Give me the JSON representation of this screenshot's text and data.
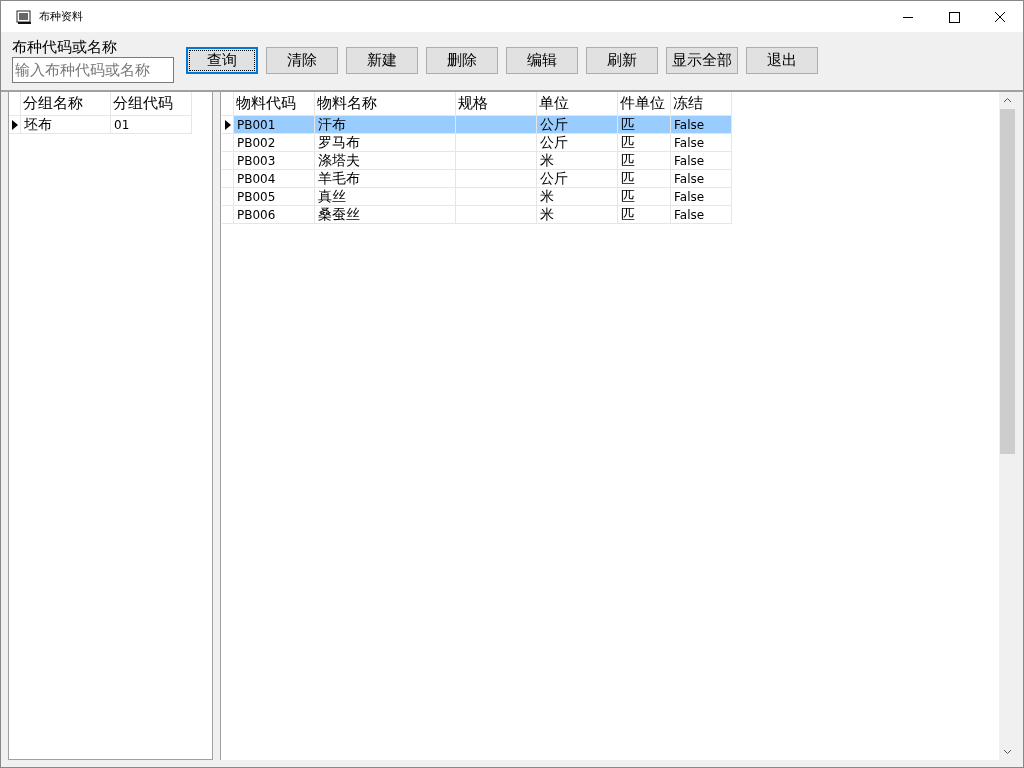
{
  "window": {
    "title": "布种资料"
  },
  "search": {
    "label": "布种代码或名称",
    "placeholder": "输入布种代码或名称"
  },
  "buttons": [
    {
      "label": "查询",
      "focused": true
    },
    {
      "label": "清除",
      "focused": false
    },
    {
      "label": "新建",
      "focused": false
    },
    {
      "label": "删除",
      "focused": false
    },
    {
      "label": "编辑",
      "focused": false
    },
    {
      "label": "刷新",
      "focused": false
    },
    {
      "label": "显示全部",
      "focused": false
    },
    {
      "label": "退出",
      "focused": false
    }
  ],
  "group_table": {
    "columns": [
      "分组名称",
      "分组代码"
    ],
    "rows": [
      {
        "cells": [
          "坯布",
          "01"
        ],
        "selected": true
      }
    ]
  },
  "material_table": {
    "columns": [
      "物料代码",
      "物料名称",
      "规格",
      "单位",
      "件单位",
      "冻结"
    ],
    "rows": [
      {
        "cells": [
          "PB001",
          "汗布",
          "",
          "公斤",
          "匹",
          "False"
        ],
        "selected": true
      },
      {
        "cells": [
          "PB002",
          "罗马布",
          "",
          "公斤",
          "匹",
          "False"
        ],
        "selected": false
      },
      {
        "cells": [
          "PB003",
          "涤塔夫",
          "",
          "米",
          "匹",
          "False"
        ],
        "selected": false
      },
      {
        "cells": [
          "PB004",
          "羊毛布",
          "",
          "公斤",
          "匹",
          "False"
        ],
        "selected": false
      },
      {
        "cells": [
          "PB005",
          "真丝",
          "",
          "米",
          "匹",
          "False"
        ],
        "selected": false
      },
      {
        "cells": [
          "PB006",
          "桑蚕丝",
          "",
          "米",
          "匹",
          "False"
        ],
        "selected": false
      }
    ]
  }
}
